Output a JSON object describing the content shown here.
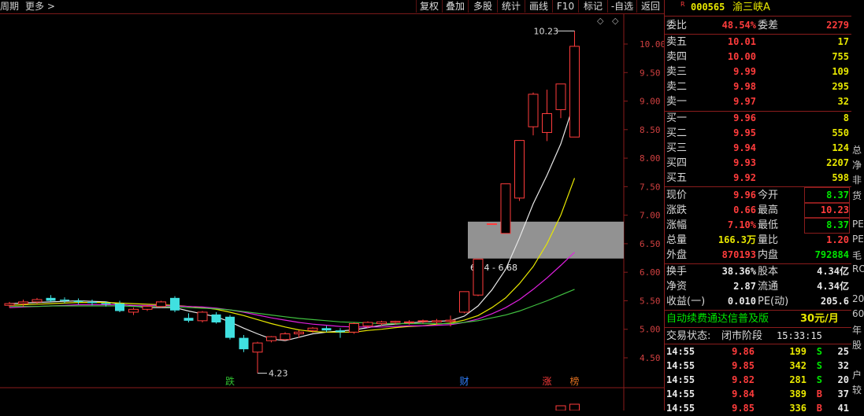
{
  "toolbar": {
    "period": "周期",
    "more": "更多 >",
    "buttons": [
      "复权",
      "叠加",
      "多股",
      "统计",
      "画线",
      "F10",
      "标记",
      "-自选",
      "返回"
    ]
  },
  "chart_data": {
    "type": "candlestick",
    "y_ticks": [
      "10.00",
      "9.50",
      "9.00",
      "8.50",
      "8.00",
      "7.50",
      "7.00",
      "6.50",
      "6.00",
      "5.50",
      "5.00",
      "4.50"
    ],
    "ylim": [
      4.23,
      10.23
    ],
    "candles": [
      {
        "o": 5.42,
        "h": 5.48,
        "l": 5.38,
        "c": 5.45
      },
      {
        "o": 5.45,
        "h": 5.52,
        "l": 5.4,
        "c": 5.48
      },
      {
        "o": 5.48,
        "h": 5.55,
        "l": 5.45,
        "c": 5.52
      },
      {
        "o": 5.55,
        "h": 5.6,
        "l": 5.48,
        "c": 5.5
      },
      {
        "o": 5.52,
        "h": 5.56,
        "l": 5.46,
        "c": 5.5
      },
      {
        "o": 5.5,
        "h": 5.54,
        "l": 5.44,
        "c": 5.48
      },
      {
        "o": 5.48,
        "h": 5.52,
        "l": 5.42,
        "c": 5.46
      },
      {
        "o": 5.46,
        "h": 5.49,
        "l": 5.4,
        "c": 5.44
      },
      {
        "o": 5.45,
        "h": 5.5,
        "l": 5.3,
        "c": 5.32
      },
      {
        "o": 5.3,
        "h": 5.38,
        "l": 5.25,
        "c": 5.35
      },
      {
        "o": 5.35,
        "h": 5.42,
        "l": 5.32,
        "c": 5.4
      },
      {
        "o": 5.4,
        "h": 5.5,
        "l": 5.38,
        "c": 5.48
      },
      {
        "o": 5.55,
        "h": 5.58,
        "l": 5.3,
        "c": 5.33
      },
      {
        "o": 5.2,
        "h": 5.28,
        "l": 5.12,
        "c": 5.15
      },
      {
        "o": 5.15,
        "h": 5.32,
        "l": 5.12,
        "c": 5.3
      },
      {
        "o": 5.26,
        "h": 5.3,
        "l": 5.1,
        "c": 5.12
      },
      {
        "o": 5.22,
        "h": 5.25,
        "l": 4.82,
        "c": 4.85
      },
      {
        "o": 4.85,
        "h": 4.9,
        "l": 4.6,
        "c": 4.65
      },
      {
        "o": 4.6,
        "h": 4.78,
        "l": 4.23,
        "c": 4.76
      },
      {
        "o": 4.8,
        "h": 4.88,
        "l": 4.77,
        "c": 4.87
      },
      {
        "o": 4.82,
        "h": 4.95,
        "l": 4.8,
        "c": 4.92
      },
      {
        "o": 4.92,
        "h": 4.98,
        "l": 4.85,
        "c": 4.95
      },
      {
        "o": 4.98,
        "h": 5.04,
        "l": 4.94,
        "c": 5.02
      },
      {
        "o": 5.02,
        "h": 5.06,
        "l": 4.95,
        "c": 4.98
      },
      {
        "o": 4.98,
        "h": 5.02,
        "l": 4.85,
        "c": 4.95
      },
      {
        "o": 4.95,
        "h": 5.12,
        "l": 4.92,
        "c": 5.1
      },
      {
        "o": 5.06,
        "h": 5.14,
        "l": 5.02,
        "c": 5.12
      },
      {
        "o": 5.1,
        "h": 5.15,
        "l": 5.07,
        "c": 5.13
      },
      {
        "o": 5.12,
        "h": 5.15,
        "l": 5.08,
        "c": 5.14
      },
      {
        "o": 5.12,
        "h": 5.16,
        "l": 5.08,
        "c": 5.13
      },
      {
        "o": 5.14,
        "h": 5.17,
        "l": 5.1,
        "c": 5.15
      },
      {
        "o": 5.13,
        "h": 5.18,
        "l": 5.08,
        "c": 5.15
      },
      {
        "o": 5.14,
        "h": 5.24,
        "l": 5.05,
        "c": 5.16
      },
      {
        "o": 5.3,
        "h": 5.66,
        "l": 5.28,
        "c": 5.66
      },
      {
        "o": 5.6,
        "h": 6.23,
        "l": 5.58,
        "c": 6.23
      },
      {
        "o": 6.85,
        "h": 6.85,
        "l": 6.85,
        "c": 6.85
      },
      {
        "o": 6.68,
        "h": 7.55,
        "l": 6.68,
        "c": 7.55
      },
      {
        "o": 7.3,
        "h": 8.31,
        "l": 7.25,
        "c": 8.31
      },
      {
        "o": 8.55,
        "h": 9.15,
        "l": 8.4,
        "c": 9.12
      },
      {
        "o": 8.45,
        "h": 9.2,
        "l": 8.3,
        "c": 8.78
      },
      {
        "o": 8.85,
        "h": 9.3,
        "l": 8.7,
        "c": 9.3
      },
      {
        "o": 8.37,
        "h": 10.23,
        "l": 8.37,
        "c": 9.96
      }
    ],
    "ma_series": [
      {
        "color": "#e8e8e8",
        "values": [
          5.45,
          5.46,
          5.47,
          5.48,
          5.49,
          5.5,
          5.49,
          5.48,
          5.44,
          5.41,
          5.38,
          5.38,
          5.38,
          5.32,
          5.27,
          5.22,
          5.13,
          5.02,
          4.92,
          4.83,
          4.8,
          4.86,
          4.92,
          4.95,
          4.97,
          4.99,
          5.03,
          5.07,
          5.09,
          5.11,
          5.13,
          5.14,
          5.15,
          5.23,
          5.41,
          5.69,
          6.05,
          6.6,
          7.2,
          7.7,
          8.25,
          8.99
        ]
      },
      {
        "color": "#e8e800",
        "values": [
          5.42,
          5.43,
          5.44,
          5.45,
          5.46,
          5.47,
          5.47,
          5.47,
          5.46,
          5.45,
          5.44,
          5.43,
          5.42,
          5.4,
          5.38,
          5.35,
          5.3,
          5.24,
          5.17,
          5.1,
          5.04,
          4.99,
          4.96,
          4.95,
          4.95,
          4.95,
          4.98,
          5.0,
          5.03,
          5.05,
          5.06,
          5.09,
          5.11,
          5.16,
          5.24,
          5.38,
          5.55,
          5.8,
          6.1,
          6.5,
          7.0,
          7.65
        ]
      },
      {
        "color": "#e020e0",
        "values": [
          5.38,
          5.39,
          5.4,
          5.41,
          5.42,
          5.43,
          5.43,
          5.43,
          5.43,
          5.42,
          5.42,
          5.42,
          5.41,
          5.4,
          5.39,
          5.37,
          5.34,
          5.3,
          5.25,
          5.2,
          5.16,
          5.12,
          5.09,
          5.07,
          5.05,
          5.04,
          5.04,
          5.04,
          5.05,
          5.06,
          5.06,
          5.07,
          5.08,
          5.12,
          5.18,
          5.27,
          5.38,
          5.52,
          5.7,
          5.9,
          6.12,
          6.35
        ]
      },
      {
        "color": "#40c040",
        "values": [
          5.4,
          5.4,
          5.4,
          5.41,
          5.41,
          5.41,
          5.41,
          5.41,
          5.41,
          5.4,
          5.4,
          5.4,
          5.39,
          5.38,
          5.37,
          5.36,
          5.34,
          5.31,
          5.28,
          5.25,
          5.22,
          5.19,
          5.17,
          5.15,
          5.13,
          5.12,
          5.11,
          5.1,
          5.1,
          5.1,
          5.1,
          5.1,
          5.1,
          5.12,
          5.15,
          5.2,
          5.25,
          5.32,
          5.41,
          5.5,
          5.6,
          5.7
        ]
      }
    ],
    "box_label": "6.24 - 6.68",
    "box_range": [
      6.24,
      6.68
    ],
    "high_label": "10.23",
    "low_label": "4.23",
    "markers": [
      {
        "text": "跌",
        "bar": 16,
        "color": "#30c030"
      },
      {
        "text": "财",
        "bar": 33,
        "color": "#3080ff"
      },
      {
        "text": "涨",
        "bar": 39,
        "color": "#ff3c3c"
      },
      {
        "text": "榜",
        "bar": 41,
        "color": "#e07020"
      }
    ]
  },
  "quote": {
    "code": "000565",
    "name": "渝三峡A",
    "weibi_label": "委比",
    "weibi": "48.54%",
    "weicha_label": "委差",
    "weicha": "2279",
    "asks": [
      {
        "label": "卖五",
        "price": "10.01",
        "vol": "17"
      },
      {
        "label": "卖四",
        "price": "10.00",
        "vol": "755"
      },
      {
        "label": "卖三",
        "price": "9.99",
        "vol": "109"
      },
      {
        "label": "卖二",
        "price": "9.98",
        "vol": "295"
      },
      {
        "label": "卖一",
        "price": "9.97",
        "vol": "32"
      }
    ],
    "bids": [
      {
        "label": "买一",
        "price": "9.96",
        "vol": "8"
      },
      {
        "label": "买二",
        "price": "9.95",
        "vol": "550"
      },
      {
        "label": "买三",
        "price": "9.94",
        "vol": "124"
      },
      {
        "label": "买四",
        "price": "9.93",
        "vol": "2207"
      },
      {
        "label": "买五",
        "price": "9.92",
        "vol": "598"
      }
    ],
    "stats": [
      {
        "l1": "现价",
        "v1": "9.96",
        "l2": "今开",
        "v2": "8.37"
      },
      {
        "l1": "涨跌",
        "v1": "0.66",
        "l2": "最高",
        "v2": "10.23"
      },
      {
        "l1": "涨幅",
        "v1": "7.10%",
        "l2": "最低",
        "v2": "8.37"
      },
      {
        "l1": "总量",
        "v1": "166.3万",
        "l2": "量比",
        "v2": "1.20"
      },
      {
        "l1": "外盘",
        "v1": "870193",
        "l2": "内盘",
        "v2": "792884"
      }
    ],
    "fund": [
      {
        "l1": "换手",
        "v1": "38.36%",
        "l2": "股本",
        "v2": "4.34亿"
      },
      {
        "l1": "净资",
        "v1": "2.87",
        "l2": "流通",
        "v2": "4.34亿"
      },
      {
        "l1": "收益(一)",
        "v1": "0.010",
        "l2": "PE(动)",
        "v2": "205.6"
      }
    ],
    "ad_text": "自动续费通达信普及版",
    "ad_price": "30元/月",
    "status_label": "交易状态:",
    "status_value": "闭市阶段",
    "status_time": "15:33:15",
    "ticks": [
      {
        "t": "14:55",
        "p": "9.86",
        "v": "199",
        "d": "S",
        "n": "25"
      },
      {
        "t": "14:55",
        "p": "9.85",
        "v": "342",
        "d": "S",
        "n": "32"
      },
      {
        "t": "14:55",
        "p": "9.82",
        "v": "281",
        "d": "S",
        "n": "20"
      },
      {
        "t": "14:55",
        "p": "9.84",
        "v": "389",
        "d": "B",
        "n": "37"
      },
      {
        "t": "14:55",
        "p": "9.85",
        "v": "336",
        "d": "B",
        "n": "41"
      }
    ]
  },
  "edge": [
    "总",
    "净",
    "非",
    "货",
    "PE",
    "PE",
    "毛",
    "RO",
    "20",
    "60",
    "年",
    "股",
    "户",
    "较"
  ]
}
